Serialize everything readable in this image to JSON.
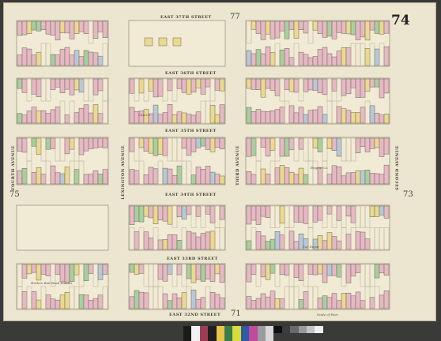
{
  "sheet": {
    "number": "74",
    "top_number": "77",
    "bottom_number": "71",
    "left_number": "75",
    "right_number": "73"
  },
  "streets": {
    "s37": "EAST 37TH STREET",
    "s36": "EAST 36TH STREET",
    "s35": "EAST 35TH STREET",
    "s34": "EAST 34TH STREET",
    "s33": "EAST 33RD STREET",
    "s32": "EAST 32ND STREET"
  },
  "avenues": {
    "fourth": "FOURTH AVENUE",
    "lexington": "LEXINGTON AVENUE",
    "third": "THIRD AVENUE",
    "second": "SECOND AVENUE"
  },
  "labels": {
    "church": "Church",
    "railroad": "Harlem Rail Road Stables",
    "depot": "Car Depot",
    "fire": "Engine Co.",
    "scale": "Scale of Feet"
  },
  "colors": {
    "paper": "#ece5cf",
    "brick": "#e6b9c4",
    "stone": "#ead98f",
    "frame": "#a9cf9f",
    "special": "#b7c9d8",
    "street_line": "#6b6656"
  },
  "calibration": {
    "colors": [
      "#1a1a1a",
      "#f2f2f2",
      "#a03c52",
      "#1f1f1f",
      "#e8c54a",
      "#3a7d4a",
      "#d7dd3a",
      "#2f5aa8",
      "#c04a9e",
      "#9b9b9b",
      "#d8d8d8"
    ],
    "grays": [
      "#101010",
      "#3c3c3c",
      "#6a6a6a",
      "#999999",
      "#c4c4c4",
      "#efefef"
    ]
  }
}
